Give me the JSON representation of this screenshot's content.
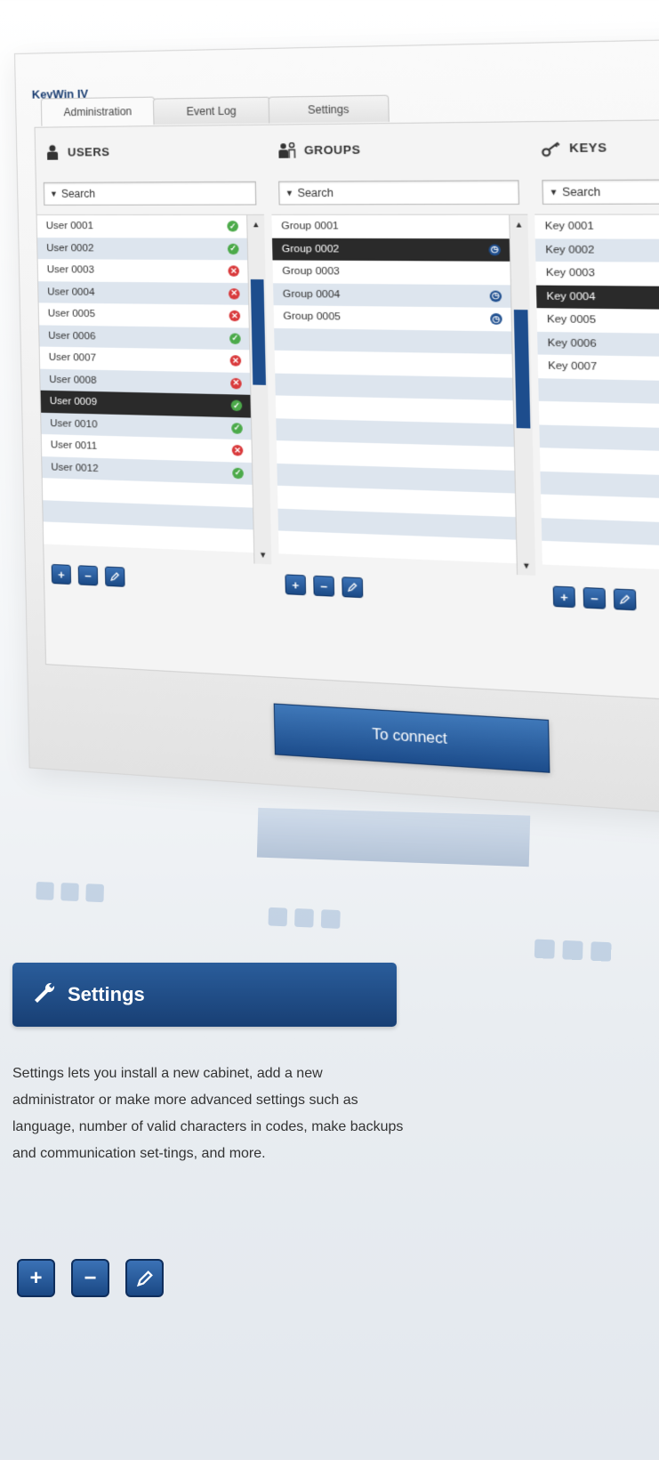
{
  "app": {
    "title": "KeyWin IV",
    "tabs": [
      {
        "label": "Administration",
        "active": true
      },
      {
        "label": "Event Log",
        "active": false
      },
      {
        "label": "Settings",
        "active": false
      }
    ]
  },
  "users": {
    "title": "USERS",
    "search_label": "Search",
    "items": [
      {
        "label": "User 0001",
        "status": "ok"
      },
      {
        "label": "User 0002",
        "status": "ok"
      },
      {
        "label": "User 0003",
        "status": "bad"
      },
      {
        "label": "User 0004",
        "status": "bad"
      },
      {
        "label": "User 0005",
        "status": "bad"
      },
      {
        "label": "User 0006",
        "status": "ok"
      },
      {
        "label": "User 0007",
        "status": "bad"
      },
      {
        "label": "User 0008",
        "status": "bad"
      },
      {
        "label": "User 0009",
        "status": "ok",
        "selected": true
      },
      {
        "label": "User 0010",
        "status": "ok"
      },
      {
        "label": "User 0011",
        "status": "bad"
      },
      {
        "label": "User 0012",
        "status": "ok"
      }
    ]
  },
  "groups": {
    "title": "GROUPS",
    "search_label": "Search",
    "items": [
      {
        "label": "Group 0001",
        "status": ""
      },
      {
        "label": "Group 0002",
        "status": "clock",
        "selected": true
      },
      {
        "label": "Group 0003",
        "status": ""
      },
      {
        "label": "Group 0004",
        "status": "clock"
      },
      {
        "label": "Group 0005",
        "status": "clock"
      }
    ]
  },
  "keys": {
    "title": "KEYS",
    "search_label": "Search",
    "items": [
      {
        "label": "Key 0001"
      },
      {
        "label": "Key 0002"
      },
      {
        "label": "Key 0003"
      },
      {
        "label": "Key 0004",
        "selected": true
      },
      {
        "label": "Key 0005"
      },
      {
        "label": "Key 0006"
      },
      {
        "label": "Key 0007"
      }
    ]
  },
  "buttons": {
    "add": "+",
    "remove": "−",
    "edit_icon": "pencil-icon"
  },
  "connect_label": "To connect",
  "section": {
    "title": "Settings",
    "icon": "wrench-icon",
    "description": "Settings lets you install a new cabinet, add a new administrator or make more advanced settings such as language, number of valid characters in codes, make backups and communication set-tings, and more."
  },
  "colors": {
    "accent": "#1c4c8b",
    "ok": "#4caa4a",
    "bad": "#d9393b",
    "row_alt": "#dde5ee",
    "selected": "#2a2a2a"
  }
}
